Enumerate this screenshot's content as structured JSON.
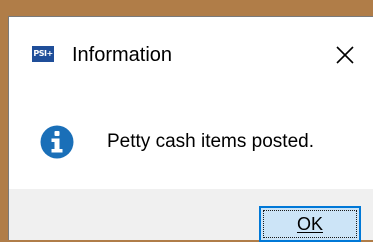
{
  "dialog": {
    "app_icon_text": "PSI+",
    "title": "Information",
    "close_glyph": "✕",
    "message": "Petty cash items posted.",
    "icon": "info-icon",
    "ok_label": "OK"
  },
  "colors": {
    "desktop_background": "#b07d48",
    "title_bar": "#ffffff",
    "content_background": "#ffffff",
    "footer_background": "#f0f0f0",
    "info_icon": "#1a6fb8",
    "ok_button_fill": "#cce4f7",
    "ok_button_border": "#0078d7",
    "app_icon": "#1f4e99"
  }
}
